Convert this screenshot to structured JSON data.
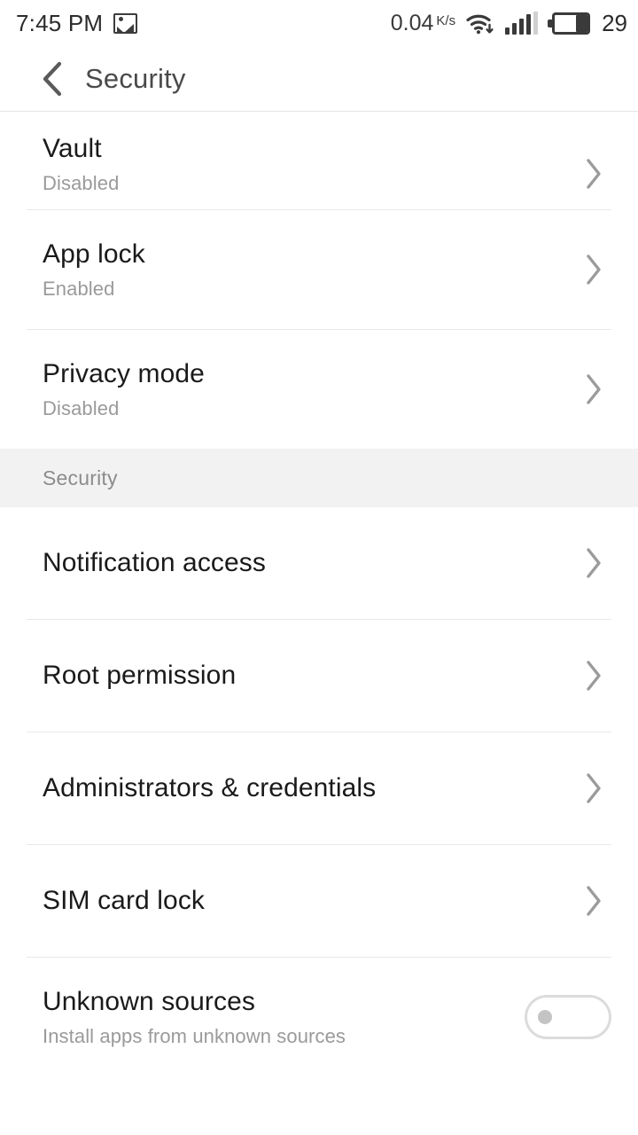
{
  "status_bar": {
    "time": "7:45 PM",
    "photo_icon": "image-icon",
    "network_speed": "0.04",
    "network_speed_unit": "K/s",
    "wifi_icon": "wifi-download-icon",
    "signal_icon": "cellular-signal-icon",
    "signal_bars_filled": 4,
    "signal_bars_total": 5,
    "battery_icon": "battery-icon",
    "battery_level": "29"
  },
  "app_bar": {
    "back_icon": "back-chevron-icon",
    "title": "Security"
  },
  "list": {
    "items": [
      {
        "kind": "nav",
        "clipped": true,
        "name": "vault",
        "title": "Vault",
        "subtitle": "Disabled",
        "accessory": "chevron-right-icon"
      },
      {
        "kind": "nav",
        "name": "app-lock",
        "title": "App lock",
        "subtitle": "Enabled",
        "accessory": "chevron-right-icon"
      },
      {
        "kind": "nav",
        "name": "privacy-mode",
        "title": "Privacy mode",
        "subtitle": "Disabled",
        "accessory": "chevron-right-icon"
      },
      {
        "kind": "section",
        "name": "security",
        "title": "Security"
      },
      {
        "kind": "nav",
        "name": "notification-access",
        "title": "Notification access",
        "accessory": "chevron-right-icon"
      },
      {
        "kind": "nav",
        "name": "root-permission",
        "title": "Root permission",
        "accessory": "chevron-right-icon"
      },
      {
        "kind": "nav",
        "name": "administrators-and-credentials",
        "title": "Administrators & credentials",
        "accessory": "chevron-right-icon"
      },
      {
        "kind": "nav",
        "name": "sim-card-lock",
        "title": "SIM card lock",
        "accessory": "chevron-right-icon"
      },
      {
        "kind": "toggle",
        "name": "unknown-sources",
        "title": "Unknown sources",
        "subtitle": "Install apps from unknown sources",
        "accessory": "toggle-switch",
        "toggle_state": "off"
      }
    ]
  },
  "colors": {
    "background": "#ffffff",
    "section_band": "#f2f2f2",
    "divider": "#e8e8e8",
    "title_text": "#1a1a1a",
    "subtitle_text": "#9a9a9a",
    "appbar_text": "#4a4a4a",
    "chevron": "#9b9b9b",
    "toggle_off_track": "#dcdcdc",
    "toggle_off_knob": "#c4c4c4"
  }
}
